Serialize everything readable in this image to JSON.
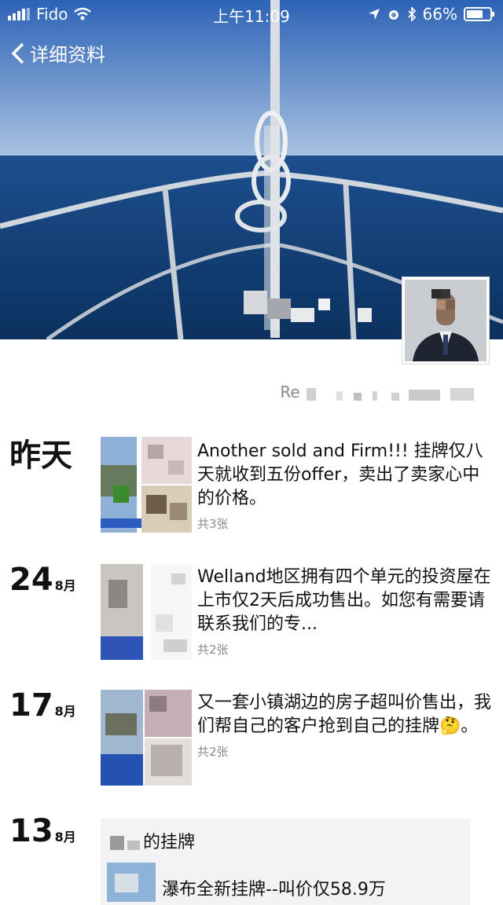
{
  "status_bar": {
    "carrier": "Fido",
    "time": "上午11:09",
    "battery": "66%",
    "icons": [
      "signal-icon",
      "wifi-icon",
      "location-icon",
      "alarm-icon",
      "bluetooth-icon",
      "battery-icon"
    ]
  },
  "nav": {
    "back_label": "详细资料",
    "back_icon": "chevron-left-icon"
  },
  "profile": {
    "signature_visible": "Re"
  },
  "posts": [
    {
      "date_day": "昨天",
      "date_month": "",
      "text": "Another sold and Firm!!! 挂牌仅八天就收到五份offer，卖出了卖家心中的价格。",
      "count": "共3张"
    },
    {
      "date_day": "24",
      "date_month": "8月",
      "text": "Welland地区拥有四个单元的投资屋在上市仅2天后成功售出。如您有需要请联系我们的专...",
      "count": "共2张"
    },
    {
      "date_day": "17",
      "date_month": "8月",
      "text": "又一套小镇湖边的房子超叫价售出，我们帮自己的客户抢到自己的挂牌🤔。",
      "count": "共2张"
    },
    {
      "date_day": "13",
      "date_month": "8月",
      "shared_title": "的挂牌",
      "shared_text": "瀑布全新挂牌--叫价仅58.9万"
    }
  ],
  "colors": {
    "sky": "#3a74c4",
    "sea": "#0f3f7a",
    "text": "#111111",
    "muted": "#8a8a8a",
    "card": "#f3f3f5"
  }
}
